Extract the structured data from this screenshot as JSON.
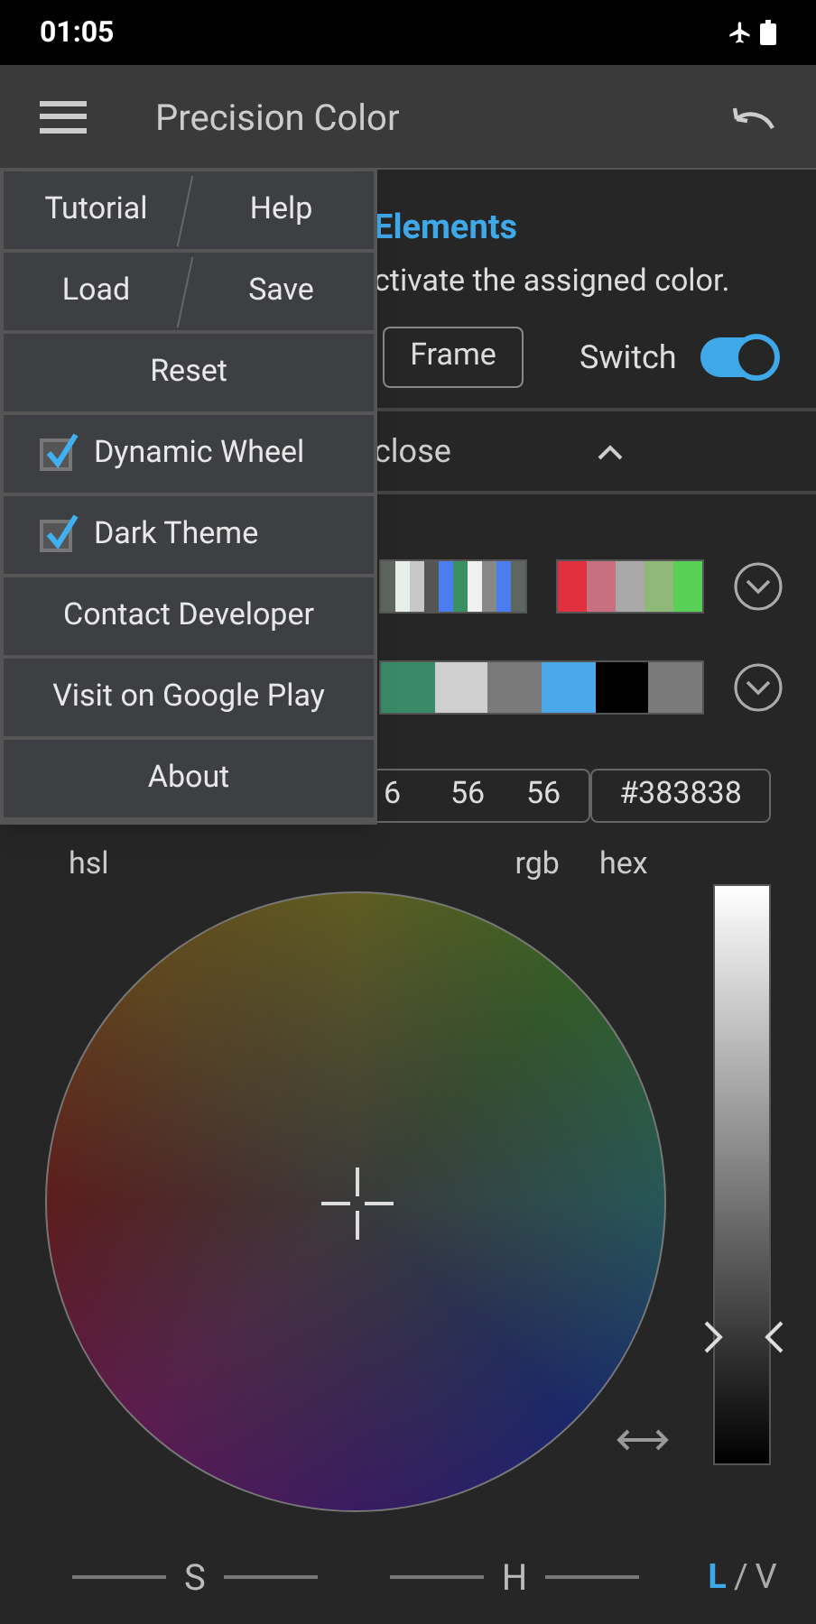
{
  "status_bar": {
    "time": "01:05"
  },
  "app_bar": {
    "title": "Precision Color"
  },
  "menu": {
    "items": [
      {
        "kind": "pair",
        "labels": [
          "Tutorial",
          "Help"
        ]
      },
      {
        "kind": "pair",
        "labels": [
          "Load",
          "Save"
        ]
      },
      {
        "kind": "button",
        "label": "Reset"
      },
      {
        "kind": "checkbox",
        "label": "Dynamic Wheel",
        "checked": true
      },
      {
        "kind": "checkbox",
        "label": "Dark Theme",
        "checked": true
      },
      {
        "kind": "button",
        "label": "Contact Developer"
      },
      {
        "kind": "button",
        "label": "Visit on Google Play"
      },
      {
        "kind": "button",
        "label": "About"
      }
    ]
  },
  "section": {
    "title": "Elements",
    "description": "ctivate the assigned color.",
    "frame_button": "Frame",
    "switch": {
      "label": "Switch",
      "on": true
    }
  },
  "collapse": {
    "label": "close",
    "expanded": true
  },
  "palettes": [
    {
      "strips": [
        [
          {
            "color": "#5f6660"
          },
          {
            "color": "#e8efe8"
          },
          {
            "color": "#c8c8c8"
          },
          {
            "color": "#555555"
          },
          {
            "color": "#4a7ef0"
          },
          {
            "color": "#3a9060"
          },
          {
            "color": "#f0f0f0"
          },
          {
            "color": "#888888"
          },
          {
            "color": "#4a7ef0"
          },
          {
            "color": "#5f6660"
          }
        ],
        [
          {
            "color": "#e03040"
          },
          {
            "color": "#c87080"
          },
          {
            "color": "#a8a8a8"
          },
          {
            "color": "#90b878"
          },
          {
            "color": "#58d058"
          }
        ]
      ]
    },
    {
      "strips": [
        [
          {
            "color": "#3a8a68"
          },
          {
            "color": "#cfcfcf"
          },
          {
            "color": "#7a7a7a"
          },
          {
            "color": "#4aa8e8"
          },
          {
            "color": "#000000"
          },
          {
            "color": "#7a7a7a"
          }
        ]
      ]
    }
  ],
  "values": {
    "rgb": [
      "6",
      "56",
      "56"
    ],
    "hex": "#383838"
  },
  "value_labels": [
    "hsl",
    "rgb",
    "hex"
  ],
  "lightness": {
    "level": 0.22
  },
  "axes": [
    "S",
    "H"
  ],
  "modes": {
    "separator": "/",
    "items": [
      {
        "label": "L",
        "selected": true
      },
      {
        "label": "V",
        "selected": false
      }
    ]
  }
}
